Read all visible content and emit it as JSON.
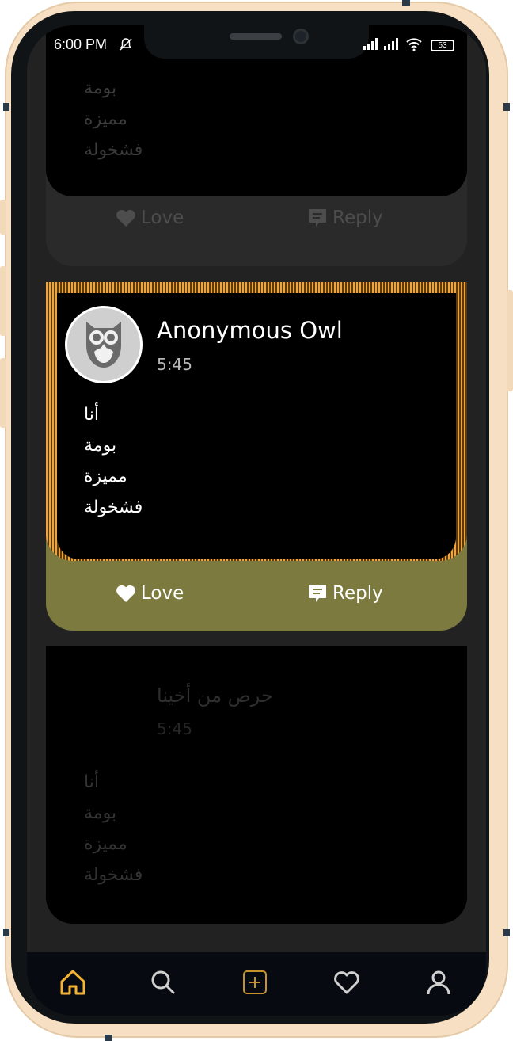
{
  "status_bar": {
    "time": "6:00 PM",
    "battery": "53"
  },
  "posts": [
    {
      "lines": [
        "بومة",
        "مميزة",
        "فشخولة"
      ],
      "love_label": "Love",
      "reply_label": "Reply"
    },
    {
      "author": "Anonymous Owl",
      "time": "5:45",
      "lines": [
        "أنا",
        "بومة",
        "مميزة",
        "فشخولة"
      ],
      "love_label": "Love",
      "reply_label": "Reply"
    },
    {
      "author": "حرص من أخينا",
      "time": "5:45",
      "lines": [
        "أنا",
        "بومة",
        "مميزة",
        "فشخولة"
      ]
    }
  ],
  "tabs": [
    {
      "icon": "home-icon",
      "active": true
    },
    {
      "icon": "search-icon",
      "active": false
    },
    {
      "icon": "add-post-icon",
      "active": false
    },
    {
      "icon": "heart-icon",
      "active": false
    },
    {
      "icon": "profile-icon",
      "active": false
    }
  ],
  "colors": {
    "accent": "#f5b335",
    "highlight_footer": "#7c7a3e",
    "card_footer": "#2a2a2a"
  }
}
